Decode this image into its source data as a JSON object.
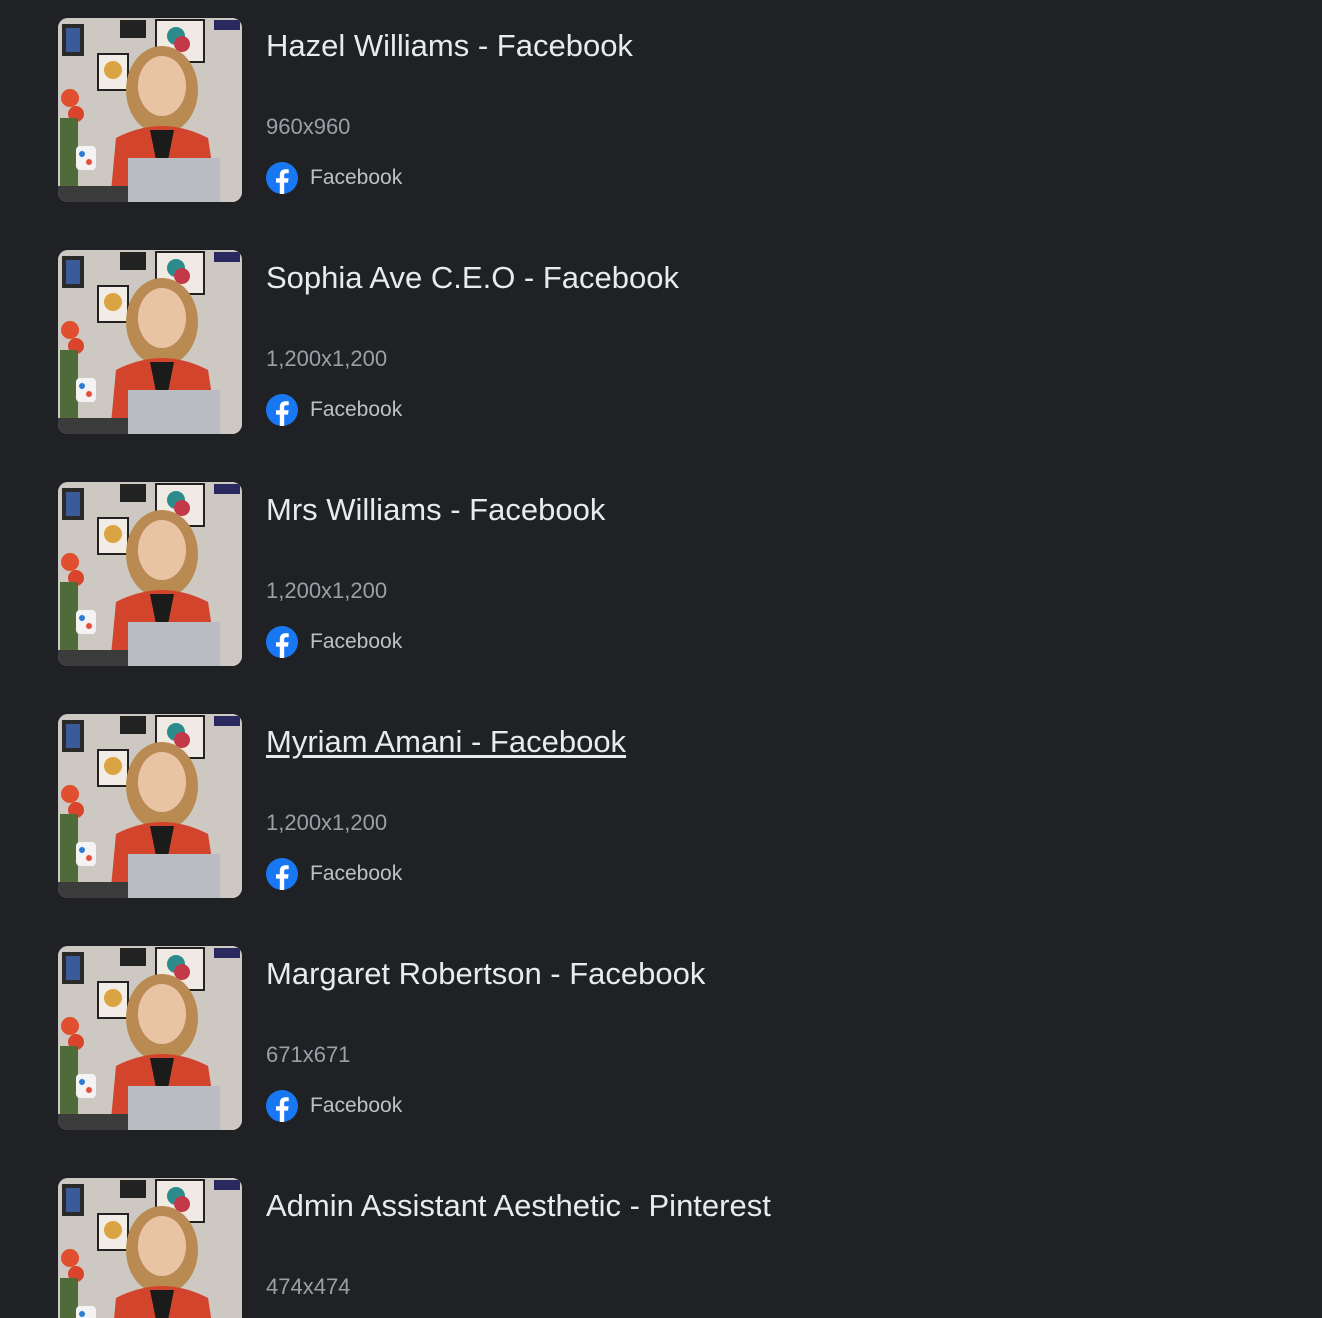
{
  "results": [
    {
      "title": "Hazel Williams - Facebook",
      "dimensions": "960x960",
      "source": "Facebook",
      "source_icon": "facebook-icon"
    },
    {
      "title": "Sophia Ave C.E.O - Facebook",
      "dimensions": "1,200x1,200",
      "source": "Facebook",
      "source_icon": "facebook-icon"
    },
    {
      "title": "Mrs Williams - Facebook",
      "dimensions": "1,200x1,200",
      "source": "Facebook",
      "source_icon": "facebook-icon"
    },
    {
      "title": "Myriam Amani - Facebook",
      "dimensions": "1,200x1,200",
      "source": "Facebook",
      "source_icon": "facebook-icon",
      "hovered": true
    },
    {
      "title": "Margaret Robertson - Facebook",
      "dimensions": "671x671",
      "source": "Facebook",
      "source_icon": "facebook-icon"
    },
    {
      "title": "Admin Assistant Aesthetic - Pinterest",
      "dimensions": "474x474"
    }
  ],
  "colors": {
    "background": "#202124",
    "title": "#e8eaed",
    "dimensions": "#9aa0a6",
    "facebook_blue": "#1877f2"
  }
}
